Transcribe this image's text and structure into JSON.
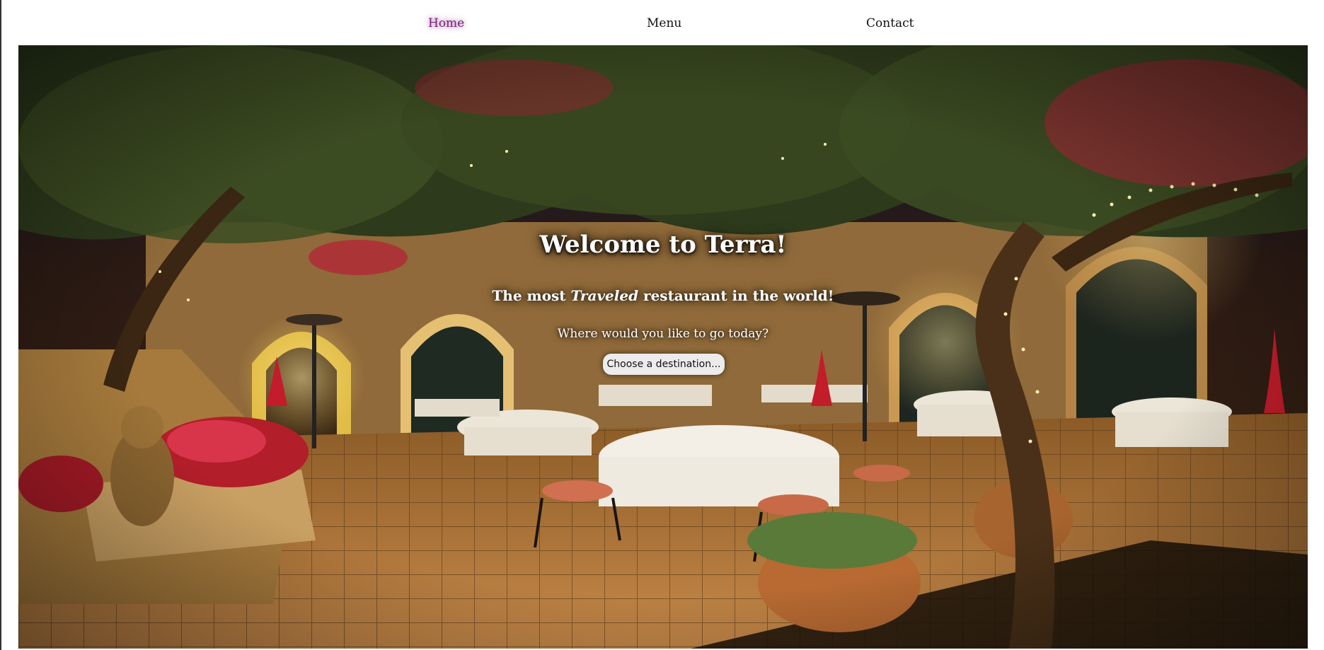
{
  "nav": {
    "items": [
      {
        "label": "Home",
        "active": true
      },
      {
        "label": "Menu",
        "active": false
      },
      {
        "label": "Contact",
        "active": false
      }
    ]
  },
  "hero": {
    "image": "restaurant-courtyard-photo",
    "heading": "Welcome to Terra!",
    "tagline_prefix": "The most ",
    "tagline_emphasis": "Traveled",
    "tagline_suffix": " restaurant in the world!",
    "prompt": "Where would you like to go today?",
    "select_label": "Choose a destination..."
  },
  "colors": {
    "active_nav": "#7a1f7a",
    "text_light": "#ffffff",
    "button_bg": "#ececec"
  }
}
